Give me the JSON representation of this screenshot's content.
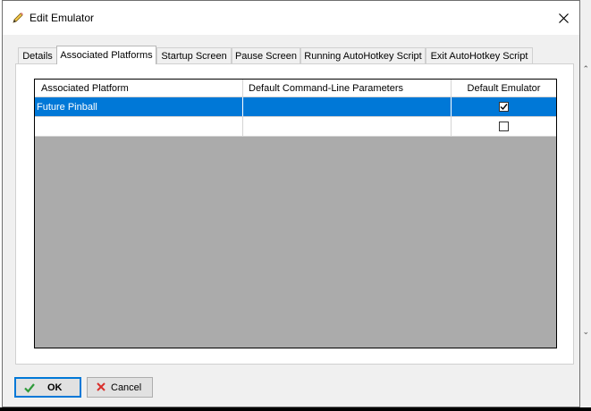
{
  "window": {
    "title": "Edit Emulator"
  },
  "tabs": [
    {
      "label": "Details"
    },
    {
      "label": "Associated Platforms"
    },
    {
      "label": "Startup Screen"
    },
    {
      "label": "Pause Screen"
    },
    {
      "label": "Running AutoHotkey Script"
    },
    {
      "label": "Exit AutoHotkey Script"
    }
  ],
  "active_tab": "Associated Platforms",
  "grid": {
    "columns": [
      "Associated Platform",
      "Default Command-Line Parameters",
      "Default Emulator"
    ],
    "rows": [
      {
        "platform": "Future Pinball",
        "params": "",
        "default_emulator": true,
        "selected": true
      },
      {
        "platform": "",
        "params": "",
        "default_emulator": false,
        "selected": false
      }
    ]
  },
  "buttons": {
    "ok": "OK",
    "cancel": "Cancel"
  },
  "colors": {
    "selection": "#0078d7",
    "grid_background": "#ababab",
    "dialog_background": "#f0f0f0"
  },
  "icons": {
    "title": "pencil-icon",
    "ok": "checkmark-icon",
    "cancel": "x-icon",
    "close": "close-icon"
  }
}
